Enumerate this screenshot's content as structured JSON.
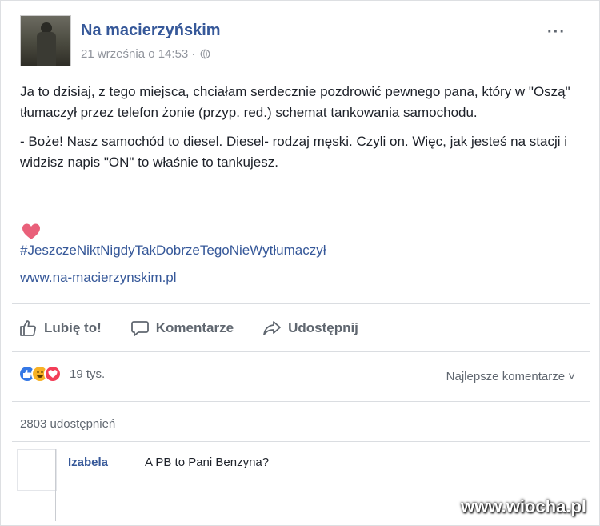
{
  "post": {
    "page_name": "Na macierzyńskim",
    "date": "21 września o 14:53 ·",
    "more": "···",
    "paragraph1": "Ja to dzisiaj, z tego miejsca, chciałam serdecznie pozdrowić pewnego pana, który w \"Oszą\" tłumaczył przez telefon żonie (przyp. red.) schemat tankowania samochodu.",
    "paragraph2": "- Boże! Nasz samochód to diesel. Diesel- rodzaj męski. Czyli on. Więc, jak jesteś na stacji i widzisz napis \"ON\" to właśnie to tankujesz.",
    "hashtag": "#JeszczeNiktNigdyTakDobrzeTegoNieWytłumaczył",
    "link": "www.na-macierzynskim.pl"
  },
  "actions": {
    "like": "Lubię to!",
    "comment": "Komentarze",
    "share": "Udostępnij"
  },
  "stats": {
    "reactions": "19 tys.",
    "sort": "Najlepsze komentarze ˅",
    "shares": "2803 udostępnień"
  },
  "comment": {
    "author": "Izabela",
    "text": "A PB to Pani Benzyna?"
  },
  "watermark": "www.wiocha.pl",
  "colors": {
    "link_blue": "#365899",
    "meta_gray": "#90949c",
    "like_blue": "#3578e5",
    "love_red": "#f33e58",
    "haha_yellow": "#f7b125"
  }
}
